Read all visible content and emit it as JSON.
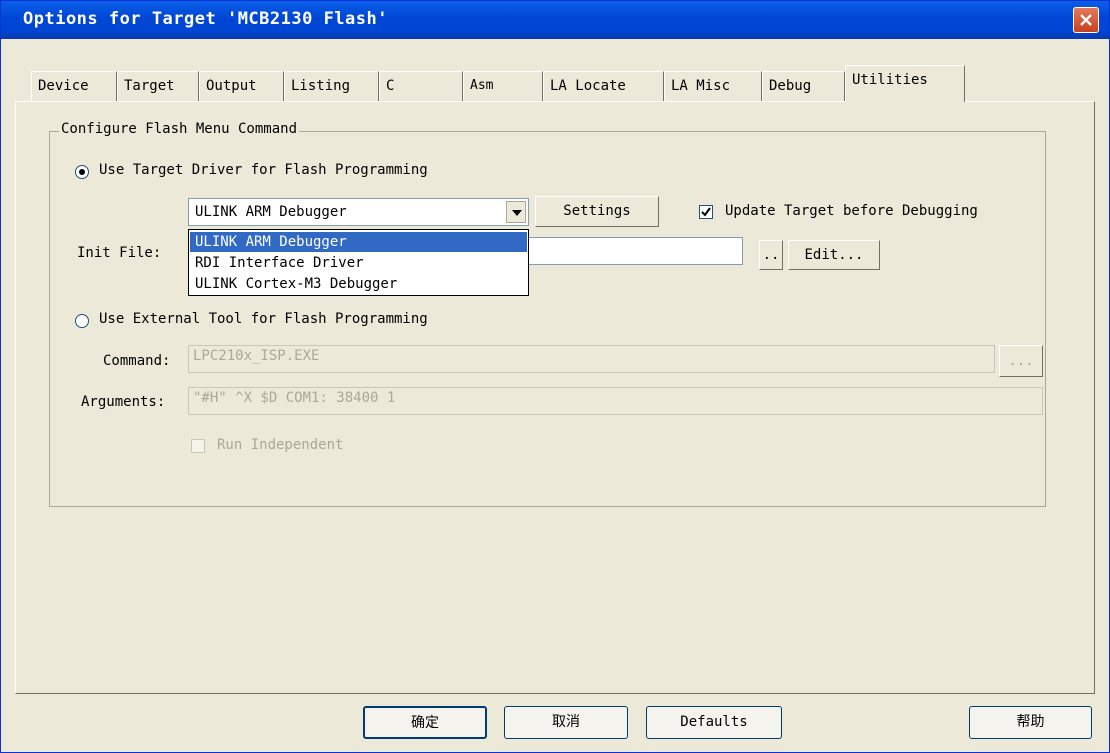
{
  "window": {
    "title": "Options for Target 'MCB2130 Flash'"
  },
  "tabs": [
    {
      "label": "Device"
    },
    {
      "label": "Target"
    },
    {
      "label": "Output"
    },
    {
      "label": "Listing"
    },
    {
      "label": "C"
    },
    {
      "label": "Asm"
    },
    {
      "label": "LA Locate"
    },
    {
      "label": "LA Misc"
    },
    {
      "label": "Debug"
    },
    {
      "label": "Utilities"
    }
  ],
  "group": {
    "label": "Configure Flash Menu Command"
  },
  "target_driver": {
    "radio_label": "Use Target Driver for Flash Programming",
    "selected": "ULINK ARM Debugger",
    "settings_label": "Settings",
    "update_label": "Update Target before Debugging",
    "options": [
      "ULINK ARM Debugger",
      "RDI Interface Driver",
      "ULINK Cortex-M3 Debugger"
    ],
    "init_file_label": "Init File:",
    "browse_label": "..",
    "edit_label": "Edit..."
  },
  "external_tool": {
    "radio_label": "Use External Tool for Flash Programming",
    "command_label": "Command:",
    "command_value": "LPC210x_ISP.EXE",
    "command_browse": "...",
    "arguments_label": "Arguments:",
    "arguments_value": "\"#H\" ^X $D COM1: 38400 1",
    "run_independent_label": "Run Independent"
  },
  "footer": {
    "ok_label": "确定",
    "cancel_label": "取消",
    "defaults_label": "Defaults",
    "help_label": "帮助"
  },
  "colors": {
    "titlebar": "#0046d5",
    "selection": "#316ac5",
    "close": "#c8401f"
  }
}
